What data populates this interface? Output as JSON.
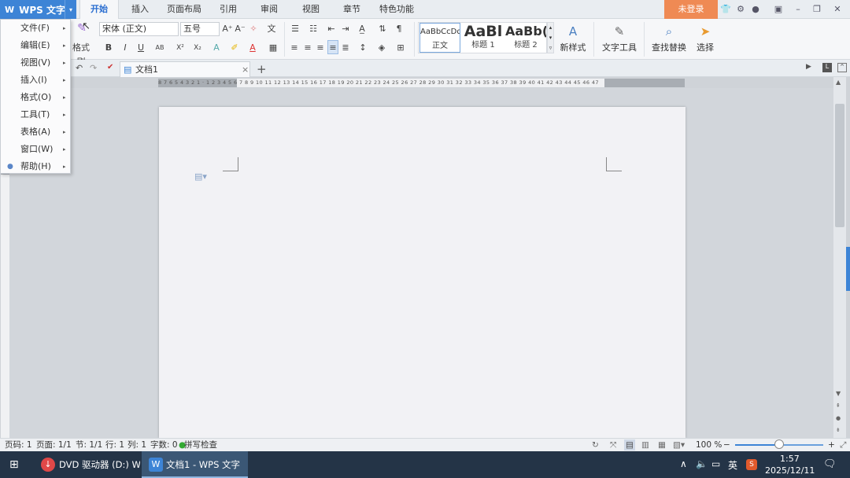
{
  "app": {
    "name": "WPS 文字",
    "logo_glyph": "W",
    "dropdown_glyph": "▾"
  },
  "ribbon_tabs": [
    "开始",
    "插入",
    "页面布局",
    "引用",
    "审阅",
    "视图",
    "章节",
    "特色功能"
  ],
  "login_label": "未登录",
  "ribbon": {
    "font_name": "宋体 (正文)",
    "font_size": "五号",
    "format_painter": "格式刷",
    "styles": [
      {
        "sample": "AaBbCcDd",
        "label": "正文"
      },
      {
        "sample": "AaBl",
        "label": "标题 1"
      },
      {
        "sample": "AaBb(",
        "label": "标题 2"
      }
    ],
    "new_style": "新样式",
    "text_tools": "文字工具",
    "find_replace": "查找替换",
    "select": "选择"
  },
  "doc_tab": {
    "title": "文档1",
    "close_glyph": "×",
    "add_glyph": "+"
  },
  "ruler": {
    "numbers": "8 7 6 5 4 3 2 1 · 1 2 3 4 5 6 7 8 9 10 11 12 13 14 15 16 17 18 19 20 21 22 23 24 25 26 27 28 29 30 31 32 33 34 35 36 37 38 39 40 41 42 43 44 45 46 47"
  },
  "menu": {
    "items": [
      {
        "label": "文件(F)"
      },
      {
        "label": "编辑(E)"
      },
      {
        "label": "视图(V)"
      },
      {
        "label": "插入(I)"
      },
      {
        "label": "格式(O)"
      },
      {
        "label": "工具(T)"
      },
      {
        "label": "表格(A)"
      },
      {
        "label": "窗口(W)"
      },
      {
        "label": "帮助(H)"
      }
    ],
    "arrow_glyph": "▸"
  },
  "status": {
    "page_num": "页码: 1",
    "pages": "页面: 1/1",
    "section": "节: 1/1",
    "row": "行: 1",
    "col": "列: 1",
    "word_count": "字数: 0",
    "spell_check": "拼写检查",
    "zoom": "100 %",
    "zoom_minus": "−",
    "zoom_plus": "+",
    "zoom_level": 0.5
  },
  "taskbar": {
    "tasks": [
      {
        "label": "DVD 驱动器 (D:) W..."
      },
      {
        "label": "文档1 - WPS 文字"
      }
    ],
    "ime": "英",
    "time": "1:57",
    "date": "2025/12/11"
  },
  "colors": {
    "accent": "#3d84d6",
    "login": "#ef8a54",
    "taskbar": "#243447",
    "active_task": "#3b5775"
  }
}
